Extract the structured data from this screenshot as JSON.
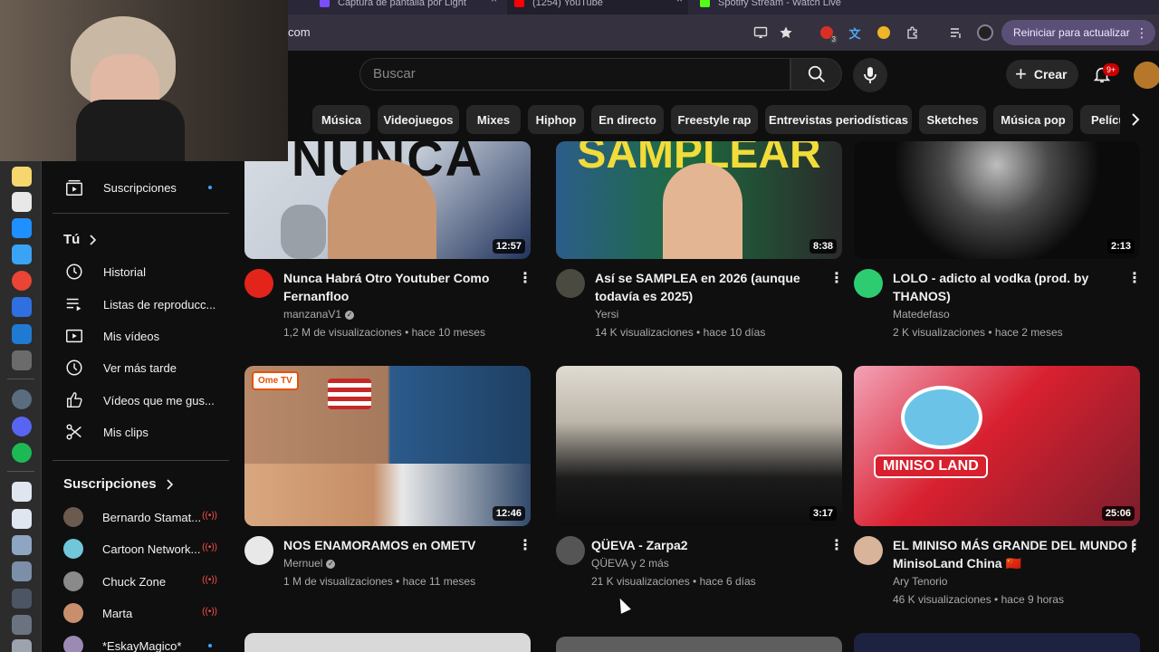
{
  "browser": {
    "tabs": [
      {
        "title": "Captura de pantalla por Light",
        "favicon_color": "#7c4dff"
      },
      {
        "title": "(1254) YouTube",
        "favicon_color": "#ff0000"
      },
      {
        "title": "Spotify Stream - Watch Live",
        "favicon_color": "#53fc18"
      }
    ],
    "url": "com",
    "update_button": "Reiniciar para actualizar",
    "ext_badge": "3"
  },
  "header": {
    "search_placeholder": "Buscar",
    "create_label": "Crear",
    "notifications_badge": "9+"
  },
  "chips": [
    "Música",
    "Videojuegos",
    "Mixes",
    "Hiphop",
    "En directo",
    "Freestyle rap",
    "Entrevistas periodísticas",
    "Sketches",
    "Música pop",
    "Pelícu"
  ],
  "sidebar": {
    "subscriptions_item": "Suscripciones",
    "you_header": "Tú",
    "you_items": [
      {
        "label": "Historial",
        "icon": "history-icon"
      },
      {
        "label": "Listas de reproducc...",
        "icon": "playlists-icon"
      },
      {
        "label": "Mis vídeos",
        "icon": "my-videos-icon"
      },
      {
        "label": "Ver más tarde",
        "icon": "watch-later-icon"
      },
      {
        "label": "Vídeos que me gus...",
        "icon": "like-icon"
      },
      {
        "label": "Mis clips",
        "icon": "scissors-icon"
      }
    ],
    "subs_header": "Suscripciones",
    "subs": [
      {
        "name": "Bernardo Stamat...",
        "status": "live",
        "color": "#6b5a4e"
      },
      {
        "name": "Cartoon Network...",
        "status": "live",
        "color": "#6fc7d9"
      },
      {
        "name": "Chuck Zone",
        "status": "live",
        "color": "#8a8a8a"
      },
      {
        "name": "Marta",
        "status": "live",
        "color": "#c98f6d"
      },
      {
        "name": "*EskayMagico*",
        "status": "new",
        "color": "#9b8bb4"
      }
    ]
  },
  "videos": [
    {
      "title": "Nunca Habrá Otro Youtuber Como Fernanfloo",
      "channel": "manzanaV1",
      "verified": true,
      "meta": "1,2 M de visualizaciones • hace 10 meses",
      "duration": "12:57",
      "avatar_color": "#e3241b",
      "thumb_colors": [
        "#cfd4da",
        "#1f3b73"
      ],
      "thumb_text": "NUNCA"
    },
    {
      "title": "Así se SAMPLEA en 2026 (aunque todavía es 2025)",
      "channel": "Yersi",
      "verified": false,
      "meta": "14 K visualizaciones • hace 10 días",
      "duration": "8:38",
      "avatar_color": "#4a4a40",
      "thumb_colors": [
        "#1c6e3a",
        "#e9d24a"
      ],
      "thumb_text": "SAMPLEAR"
    },
    {
      "title": "LOLO - adicto al vodka (prod. by THANOS)",
      "channel": "Matedefaso",
      "verified": false,
      "meta": "2 K visualizaciones • hace 2 meses",
      "duration": "2:13",
      "avatar_color": "#2ecc71",
      "thumb_colors": [
        "#0a0a0a",
        "#3a3a3a"
      ],
      "thumb_text": ""
    },
    {
      "title": "NOS ENAMORAMOS en OMETV",
      "channel": "Mernuel",
      "verified": true,
      "meta": "1 M de visualizaciones • hace 11 meses",
      "duration": "12:46",
      "avatar_color": "#e8e8e8",
      "thumb_colors": [
        "#b88a6b",
        "#2b5b8c"
      ],
      "thumb_text": "Ome TV"
    },
    {
      "title": "QÜEVA - Zarpa2",
      "channel": "QÜEVA y 2 más",
      "verified": false,
      "meta": "21 K visualizaciones • hace 6 días",
      "duration": "3:17",
      "avatar_color": "#555555",
      "thumb_colors": [
        "#d9d4cc",
        "#1a1a1a"
      ],
      "thumb_text": ""
    },
    {
      "title": "EL MINISO MÁS GRANDE DEL MUNDO | MinisoLand China 🇨🇳",
      "channel": "Ary Tenorio",
      "verified": false,
      "meta": "46 K visualizaciones • hace 9 horas",
      "duration": "25:06",
      "avatar_color": "#d8b59a",
      "thumb_colors": [
        "#d8202f",
        "#f2b8c6"
      ],
      "thumb_text": "MINISO LAND"
    }
  ]
}
